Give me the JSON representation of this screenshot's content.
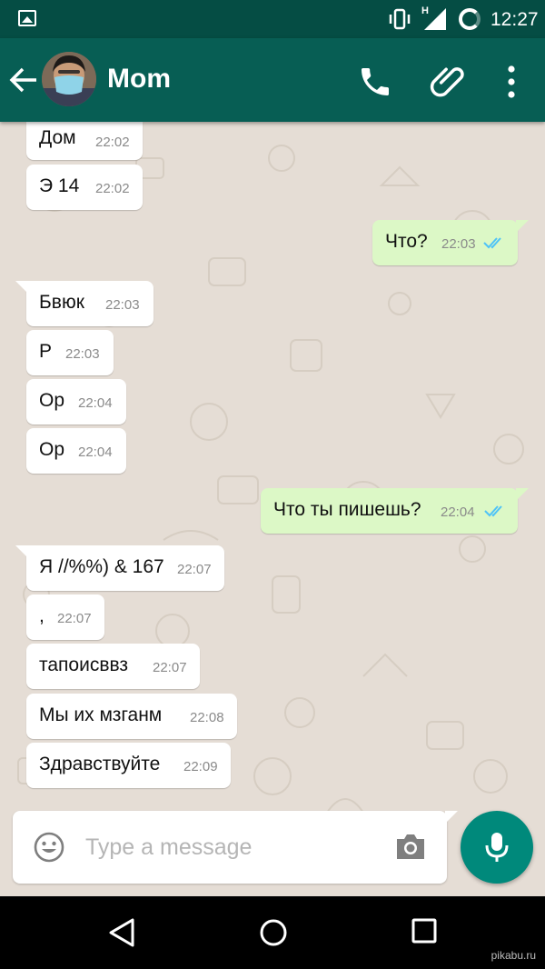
{
  "status_bar": {
    "time": "12:27",
    "network_type": "H",
    "icons": [
      "image-icon",
      "vibrate-icon",
      "signal-icon",
      "battery-ring-icon"
    ]
  },
  "header": {
    "contact_name": "Mom",
    "icons": [
      "back-arrow-icon",
      "avatar",
      "phone-icon",
      "paperclip-icon",
      "more-vert-icon"
    ]
  },
  "messages": [
    {
      "dir": "in",
      "text": "Дом",
      "time": "22:02",
      "tail": false
    },
    {
      "dir": "in",
      "text": "Э 14",
      "time": "22:02",
      "tail": false
    },
    {
      "dir": "out",
      "text": "Что?",
      "time": "22:03",
      "tail": true,
      "read": true
    },
    {
      "dir": "in",
      "text": "Бвюк",
      "time": "22:03",
      "tail": true
    },
    {
      "dir": "in",
      "text": "Р",
      "time": "22:03",
      "tail": false
    },
    {
      "dir": "in",
      "text": "Ор",
      "time": "22:04",
      "tail": false
    },
    {
      "dir": "in",
      "text": "Ор",
      "time": "22:04",
      "tail": false
    },
    {
      "dir": "out",
      "text": "Что ты пишешь?",
      "time": "22:04",
      "tail": true,
      "read": true
    },
    {
      "dir": "in",
      "text": "Я //%%) & 167",
      "time": "22:07",
      "tail": true
    },
    {
      "dir": "in",
      "text": ",",
      "time": "22:07",
      "tail": false
    },
    {
      "dir": "in",
      "text": "тапоисввз",
      "time": "22:07",
      "tail": false
    },
    {
      "dir": "in",
      "text": "Мы их мзганм",
      "time": "22:08",
      "tail": false
    },
    {
      "dir": "in",
      "text": "Здравствуйте",
      "time": "22:09",
      "tail": false
    }
  ],
  "composer": {
    "placeholder": "Type a message",
    "value": ""
  },
  "colors": {
    "status_bar": "#054d44",
    "app_bar": "#075e54",
    "chat_bg": "#e5ddd5",
    "incoming": "#ffffff",
    "outgoing": "#dcf8c6",
    "read_ticks": "#4fc3f7",
    "fab": "#00897b"
  },
  "watermark": "pikabu.ru"
}
